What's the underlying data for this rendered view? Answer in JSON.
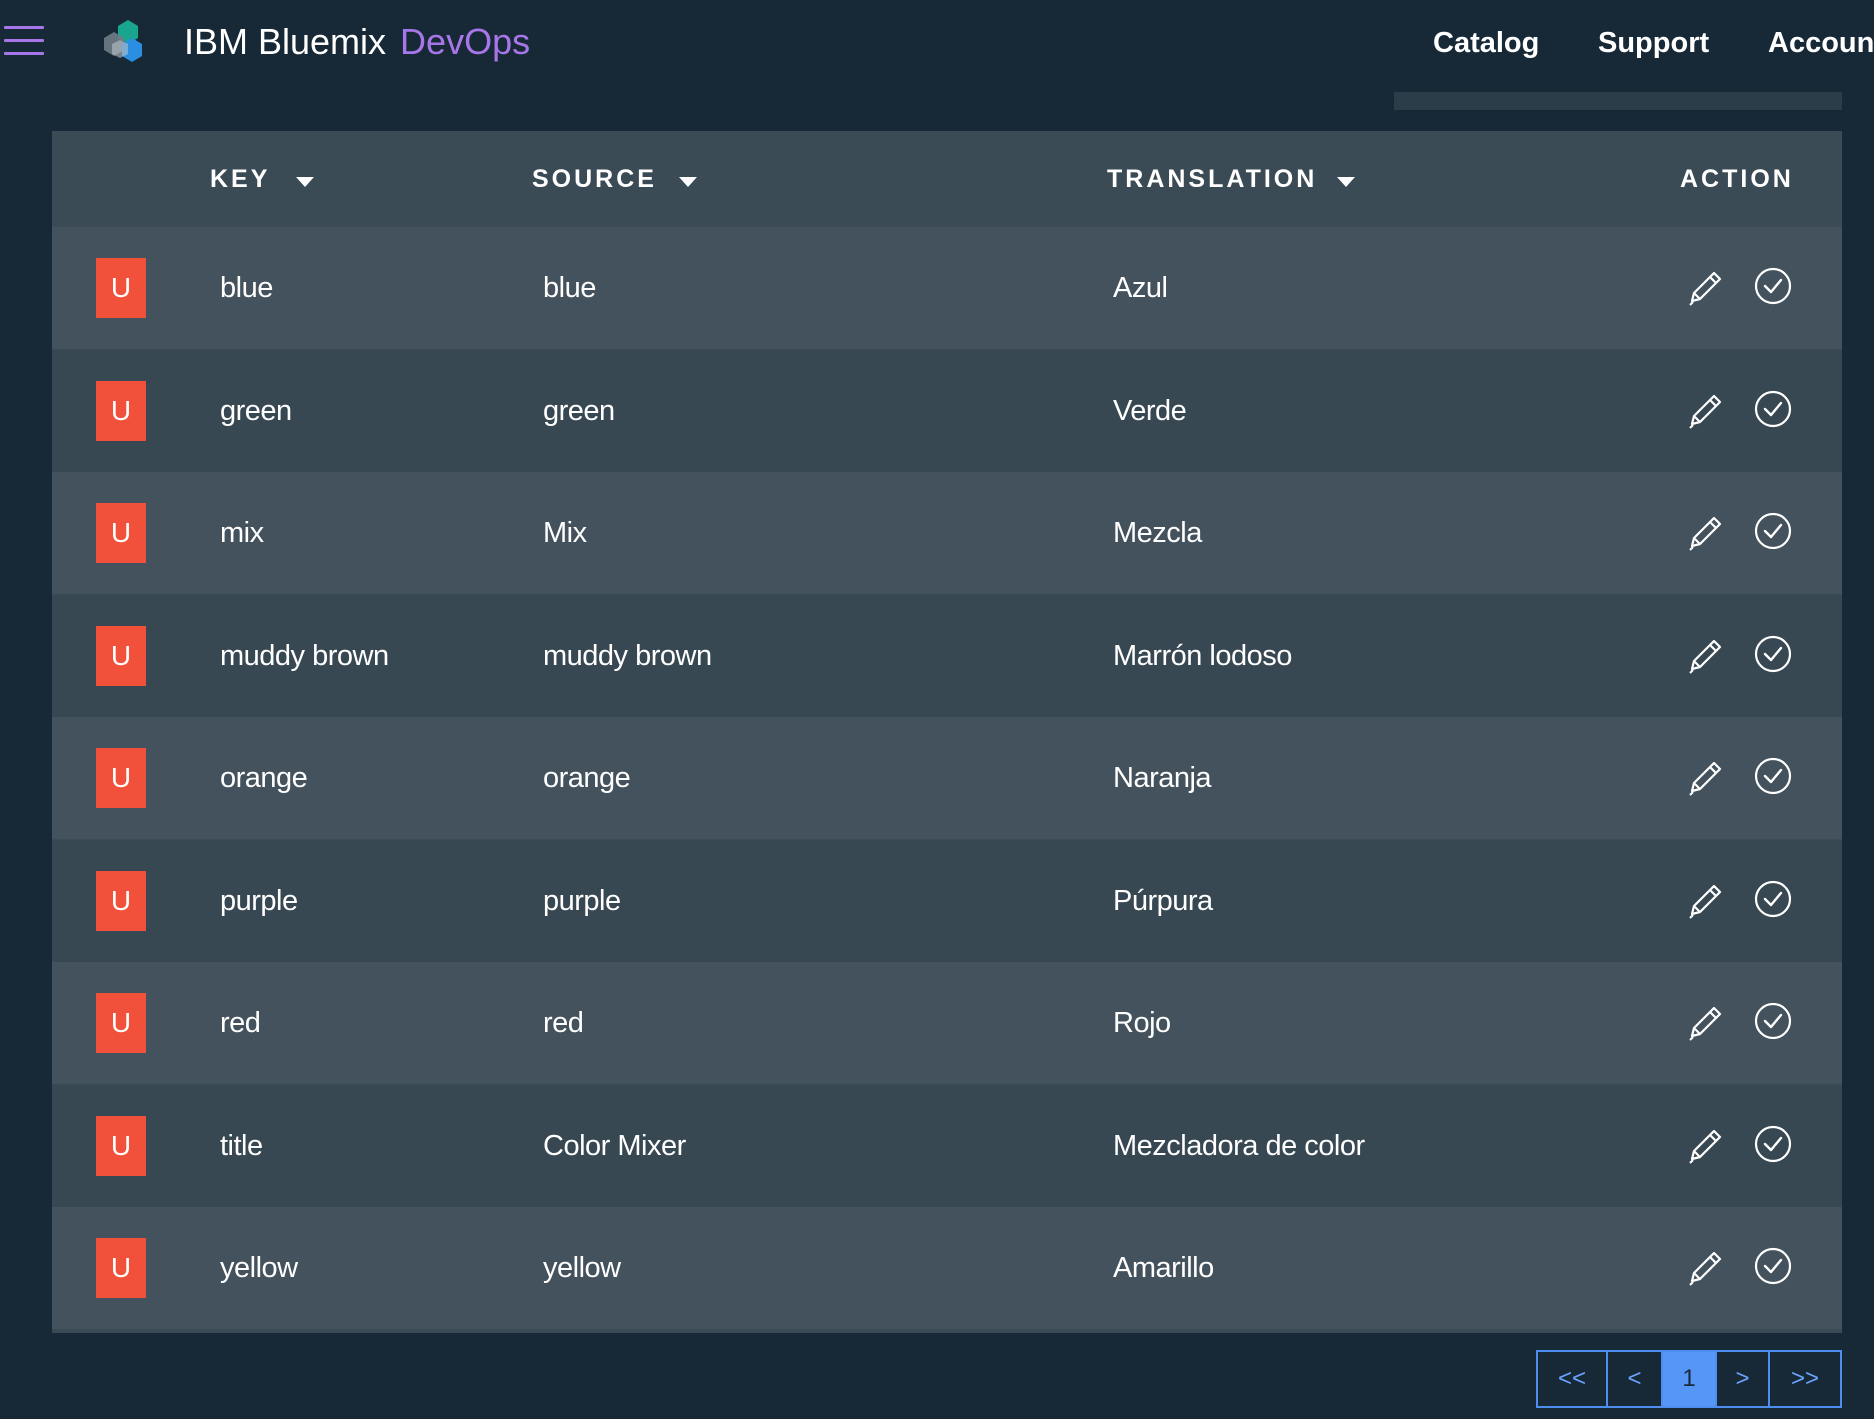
{
  "header": {
    "brand": "IBM Bluemix",
    "brand_accent": "DevOps",
    "nav": [
      "Catalog",
      "Support",
      "Account"
    ]
  },
  "table": {
    "columns": [
      "KEY",
      "SOURCE",
      "TRANSLATION",
      "ACTION"
    ],
    "rows": [
      {
        "status": "U",
        "key": "blue",
        "source": "blue",
        "translation": "Azul"
      },
      {
        "status": "U",
        "key": "green",
        "source": "green",
        "translation": "Verde"
      },
      {
        "status": "U",
        "key": "mix",
        "source": "Mix",
        "translation": "Mezcla"
      },
      {
        "status": "U",
        "key": "muddy brown",
        "source": "muddy brown",
        "translation": "Marrón lodoso"
      },
      {
        "status": "U",
        "key": "orange",
        "source": "orange",
        "translation": "Naranja"
      },
      {
        "status": "U",
        "key": "purple",
        "source": "purple",
        "translation": "Púrpura"
      },
      {
        "status": "U",
        "key": "red",
        "source": "red",
        "translation": "Rojo"
      },
      {
        "status": "U",
        "key": "title",
        "source": "Color Mixer",
        "translation": "Mezcladora de color"
      },
      {
        "status": "U",
        "key": "yellow",
        "source": "yellow",
        "translation": "Amarillo"
      }
    ]
  },
  "pagination": {
    "first": "<<",
    "prev": "<",
    "current": "1",
    "next": ">",
    "last": ">>"
  },
  "colors": {
    "background": "#172836",
    "accent": "#a776e8",
    "status_badge": "#f1503a",
    "pager": "#4d8ef0"
  }
}
